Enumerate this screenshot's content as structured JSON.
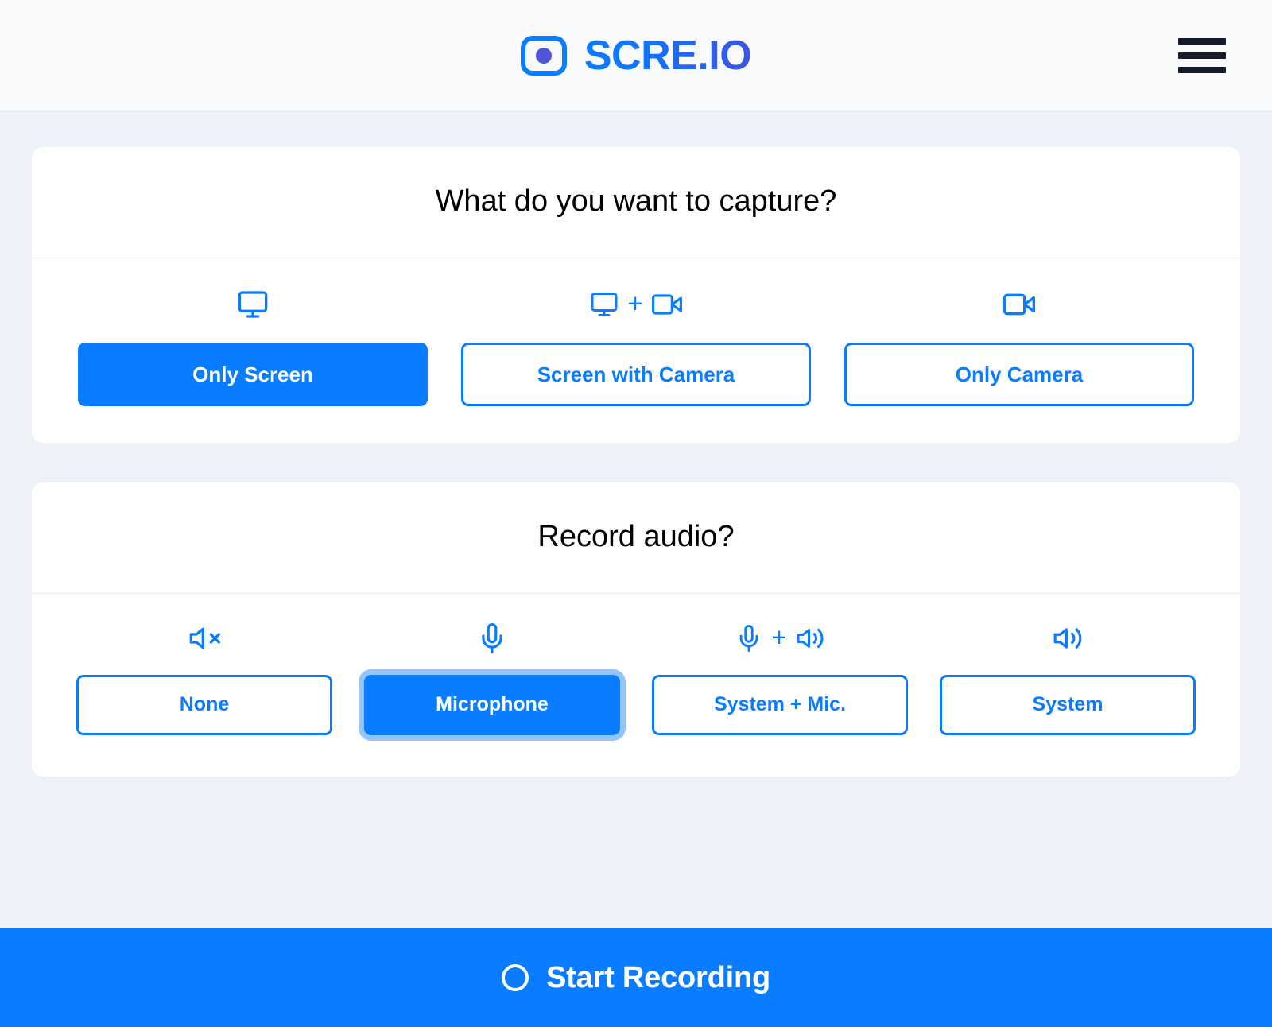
{
  "header": {
    "brand_name": "SCRE.IO",
    "brand_icon": "screen-record-logo-icon",
    "menu_icon": "hamburger-menu-icon",
    "brand_gradient_from": "#0a7cff",
    "brand_gradient_to": "#3d53e0"
  },
  "capture": {
    "title": "What do you want to capture?",
    "options": [
      {
        "label": "Only Screen",
        "icon": "monitor-icon",
        "selected": true
      },
      {
        "label": "Screen with Camera",
        "icon": "monitor-plus-camera-icon",
        "selected": false
      },
      {
        "label": "Only Camera",
        "icon": "video-camera-icon",
        "selected": false
      }
    ]
  },
  "audio": {
    "title": "Record audio?",
    "options": [
      {
        "label": "None",
        "icon": "speaker-muted-icon",
        "selected": false
      },
      {
        "label": "Microphone",
        "icon": "microphone-icon",
        "selected": true,
        "focused": true
      },
      {
        "label": "System + Mic.",
        "icon": "microphone-plus-speaker-icon",
        "selected": false
      },
      {
        "label": "System",
        "icon": "speaker-icon",
        "selected": false
      }
    ]
  },
  "footer": {
    "record_label": "Start Recording",
    "record_icon": "record-circle-icon",
    "accent_color": "#0a7cff"
  }
}
